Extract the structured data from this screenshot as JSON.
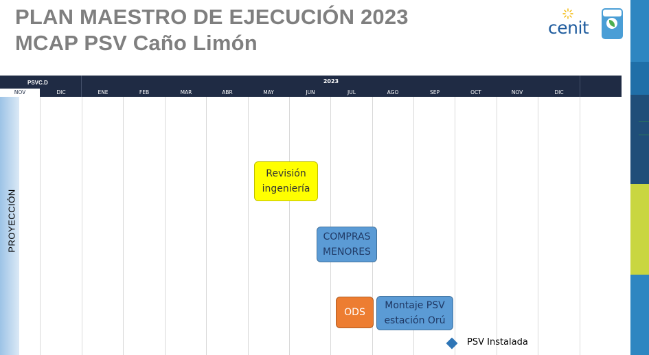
{
  "title": {
    "line1": "PLAN MAESTRO DE EJECUCIÓN 2023",
    "line2": "MCAP PSV Caño Limón"
  },
  "logo": {
    "brand": "cenit",
    "icons": [
      "sun-icon",
      "certification-badge-icon"
    ]
  },
  "table": {
    "prev_label": "PSVC.D",
    "year_label": "2023",
    "months": [
      "NOV",
      "DIC",
      "ENE",
      "FEB",
      "MAR",
      "ABR",
      "MAY",
      "JUN",
      "JUL",
      "AGO",
      "SEP",
      "OCT",
      "NOV",
      "DIC"
    ],
    "row_label": "PROYECCIÓN"
  },
  "tasks": [
    {
      "label": "Revisión ingeniería",
      "lines": [
        "Revisión",
        "ingeniería"
      ],
      "color": "#ffff00"
    },
    {
      "label": "COMPRAS MENORES",
      "lines": [
        "COMPRAS",
        "MENORES"
      ],
      "color": "#5b9bd5"
    },
    {
      "label": "ODS",
      "lines": [
        "ODS"
      ],
      "color": "#ed7d31"
    },
    {
      "label": "Montaje PSV estación Orú",
      "lines": [
        "Montaje PSV",
        "estación Orú"
      ],
      "color": "#5b9bd5"
    }
  ],
  "milestone": {
    "label": "PSV Instalada",
    "color": "#2e75b6"
  },
  "colors": {
    "header": "#1f2b44",
    "title": "#7f7f7f"
  }
}
